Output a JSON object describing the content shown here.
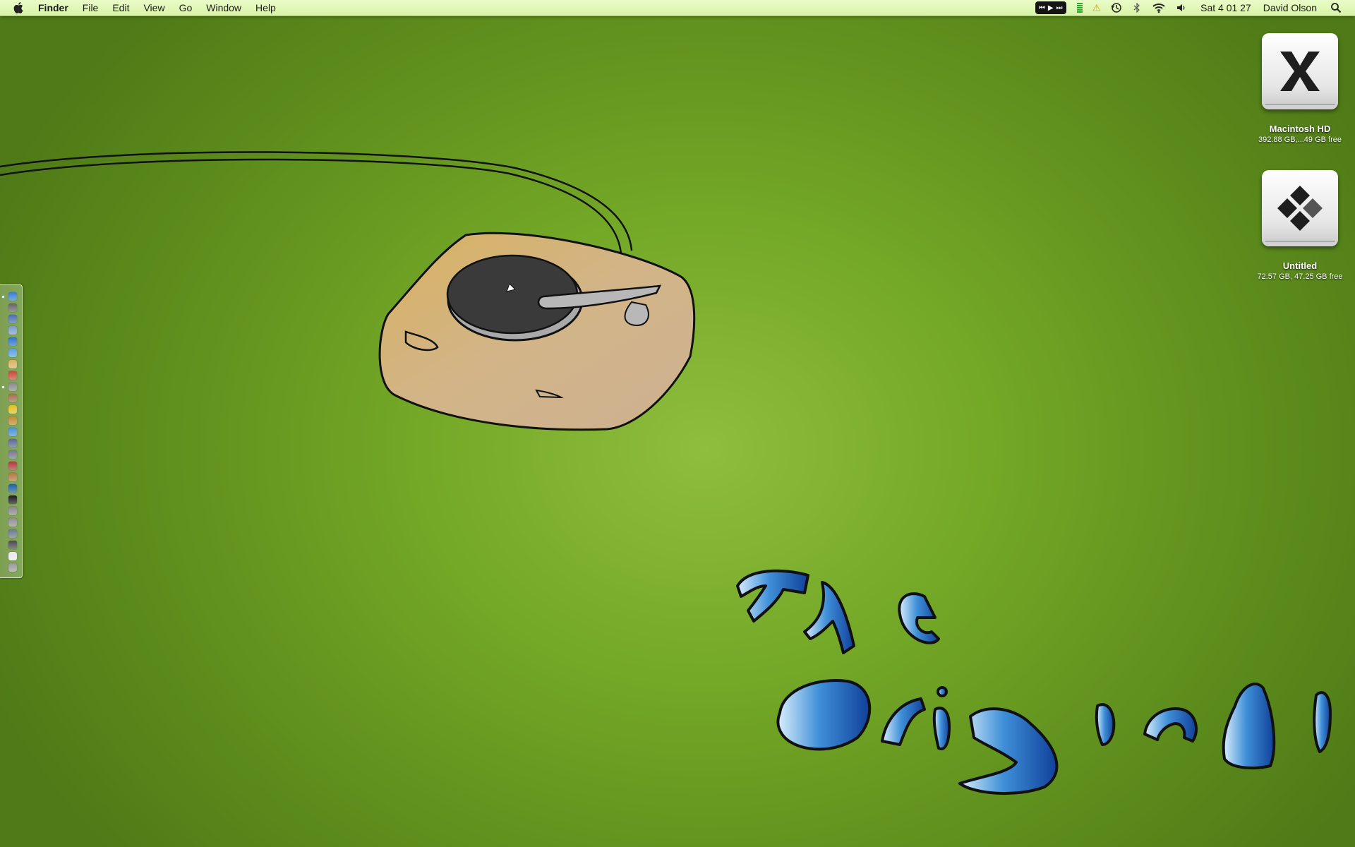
{
  "menubar": {
    "app_name": "Finder",
    "menus": [
      "File",
      "Edit",
      "View",
      "Go",
      "Window",
      "Help"
    ],
    "clock": "Sat 4 01 27",
    "user": "David Olson",
    "status_icons": [
      "media-controls-icon",
      "activity-meter-icon",
      "warning-icon",
      "time-machine-icon",
      "bluetooth-icon",
      "wifi-icon",
      "volume-icon",
      "spotlight-icon"
    ]
  },
  "desktop_items": [
    {
      "name": "Macintosh HD",
      "info": "392.88 GB,...49 GB free",
      "icon": "mac-os-x-drive-icon"
    },
    {
      "name": "Untitled",
      "info": "72.57 GB, 47.25 GB free",
      "icon": "windows-drive-icon"
    }
  ],
  "dock": {
    "position": "left",
    "icon_colors": [
      "#3a7fd0",
      "#666666",
      "#4a6fb0",
      "#7a9ec8",
      "#2f74c8",
      "#5aa0e0",
      "#d9b061",
      "#c94a3a",
      "#8a8a8a",
      "#a0704a",
      "#e0c020",
      "#c08a30",
      "#4a90d8",
      "#5a6a90",
      "#707a88",
      "#b03a3a",
      "#b07a40",
      "#2060a0",
      "#1a1a1a",
      "#8a8a8a",
      "#909090",
      "#6a7a8a",
      "#4a4a4a",
      "#e8e8e8",
      "#9a9a9a"
    ]
  },
  "colors": {
    "menubar": "#e2f8b8",
    "wallpaper": "#73a726",
    "wallpaper_text": "#2f74c8"
  },
  "wallpaper": {
    "text_lines": [
      "The",
      "Original"
    ]
  }
}
